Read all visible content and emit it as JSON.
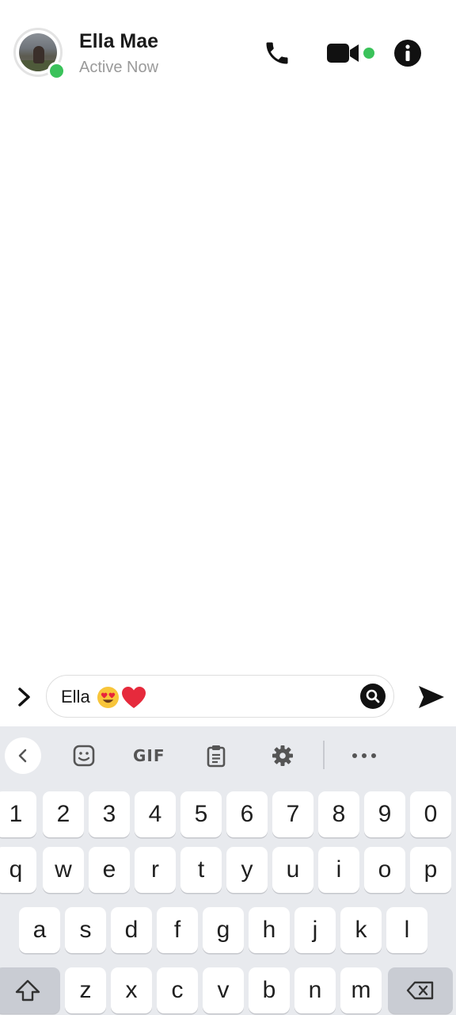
{
  "contact": {
    "name": "Ella Mae",
    "status": "Active Now",
    "online_color": "#3ac25a"
  },
  "header_actions": [
    {
      "name": "phone-icon"
    },
    {
      "name": "video-camera-icon"
    },
    {
      "name": "info-icon"
    }
  ],
  "composer": {
    "expand_icon": "chevron-right-icon",
    "text": "Ella",
    "emojis": [
      "heart-eyes-emoji",
      "red-heart-emoji"
    ],
    "search_icon": "search-icon",
    "send_icon": "send-arrow-icon"
  },
  "keyboard": {
    "toolbar": {
      "back_icon": "chevron-left-icon",
      "sticker_icon": "sticker-icon",
      "gif_label": "GIF",
      "clipboard_icon": "clipboard-icon",
      "settings_icon": "gear-icon",
      "more_icon": "more-dots-icon"
    },
    "row_numbers": [
      "1",
      "2",
      "3",
      "4",
      "5",
      "6",
      "7",
      "8",
      "9",
      "0"
    ],
    "row1": [
      "q",
      "w",
      "e",
      "r",
      "t",
      "y",
      "u",
      "i",
      "o",
      "p"
    ],
    "row2": [
      "a",
      "s",
      "d",
      "f",
      "g",
      "h",
      "j",
      "k",
      "l"
    ],
    "row3": [
      "z",
      "x",
      "c",
      "v",
      "b",
      "n",
      "m"
    ],
    "shift_icon": "shift-icon",
    "backspace_icon": "backspace-icon"
  }
}
